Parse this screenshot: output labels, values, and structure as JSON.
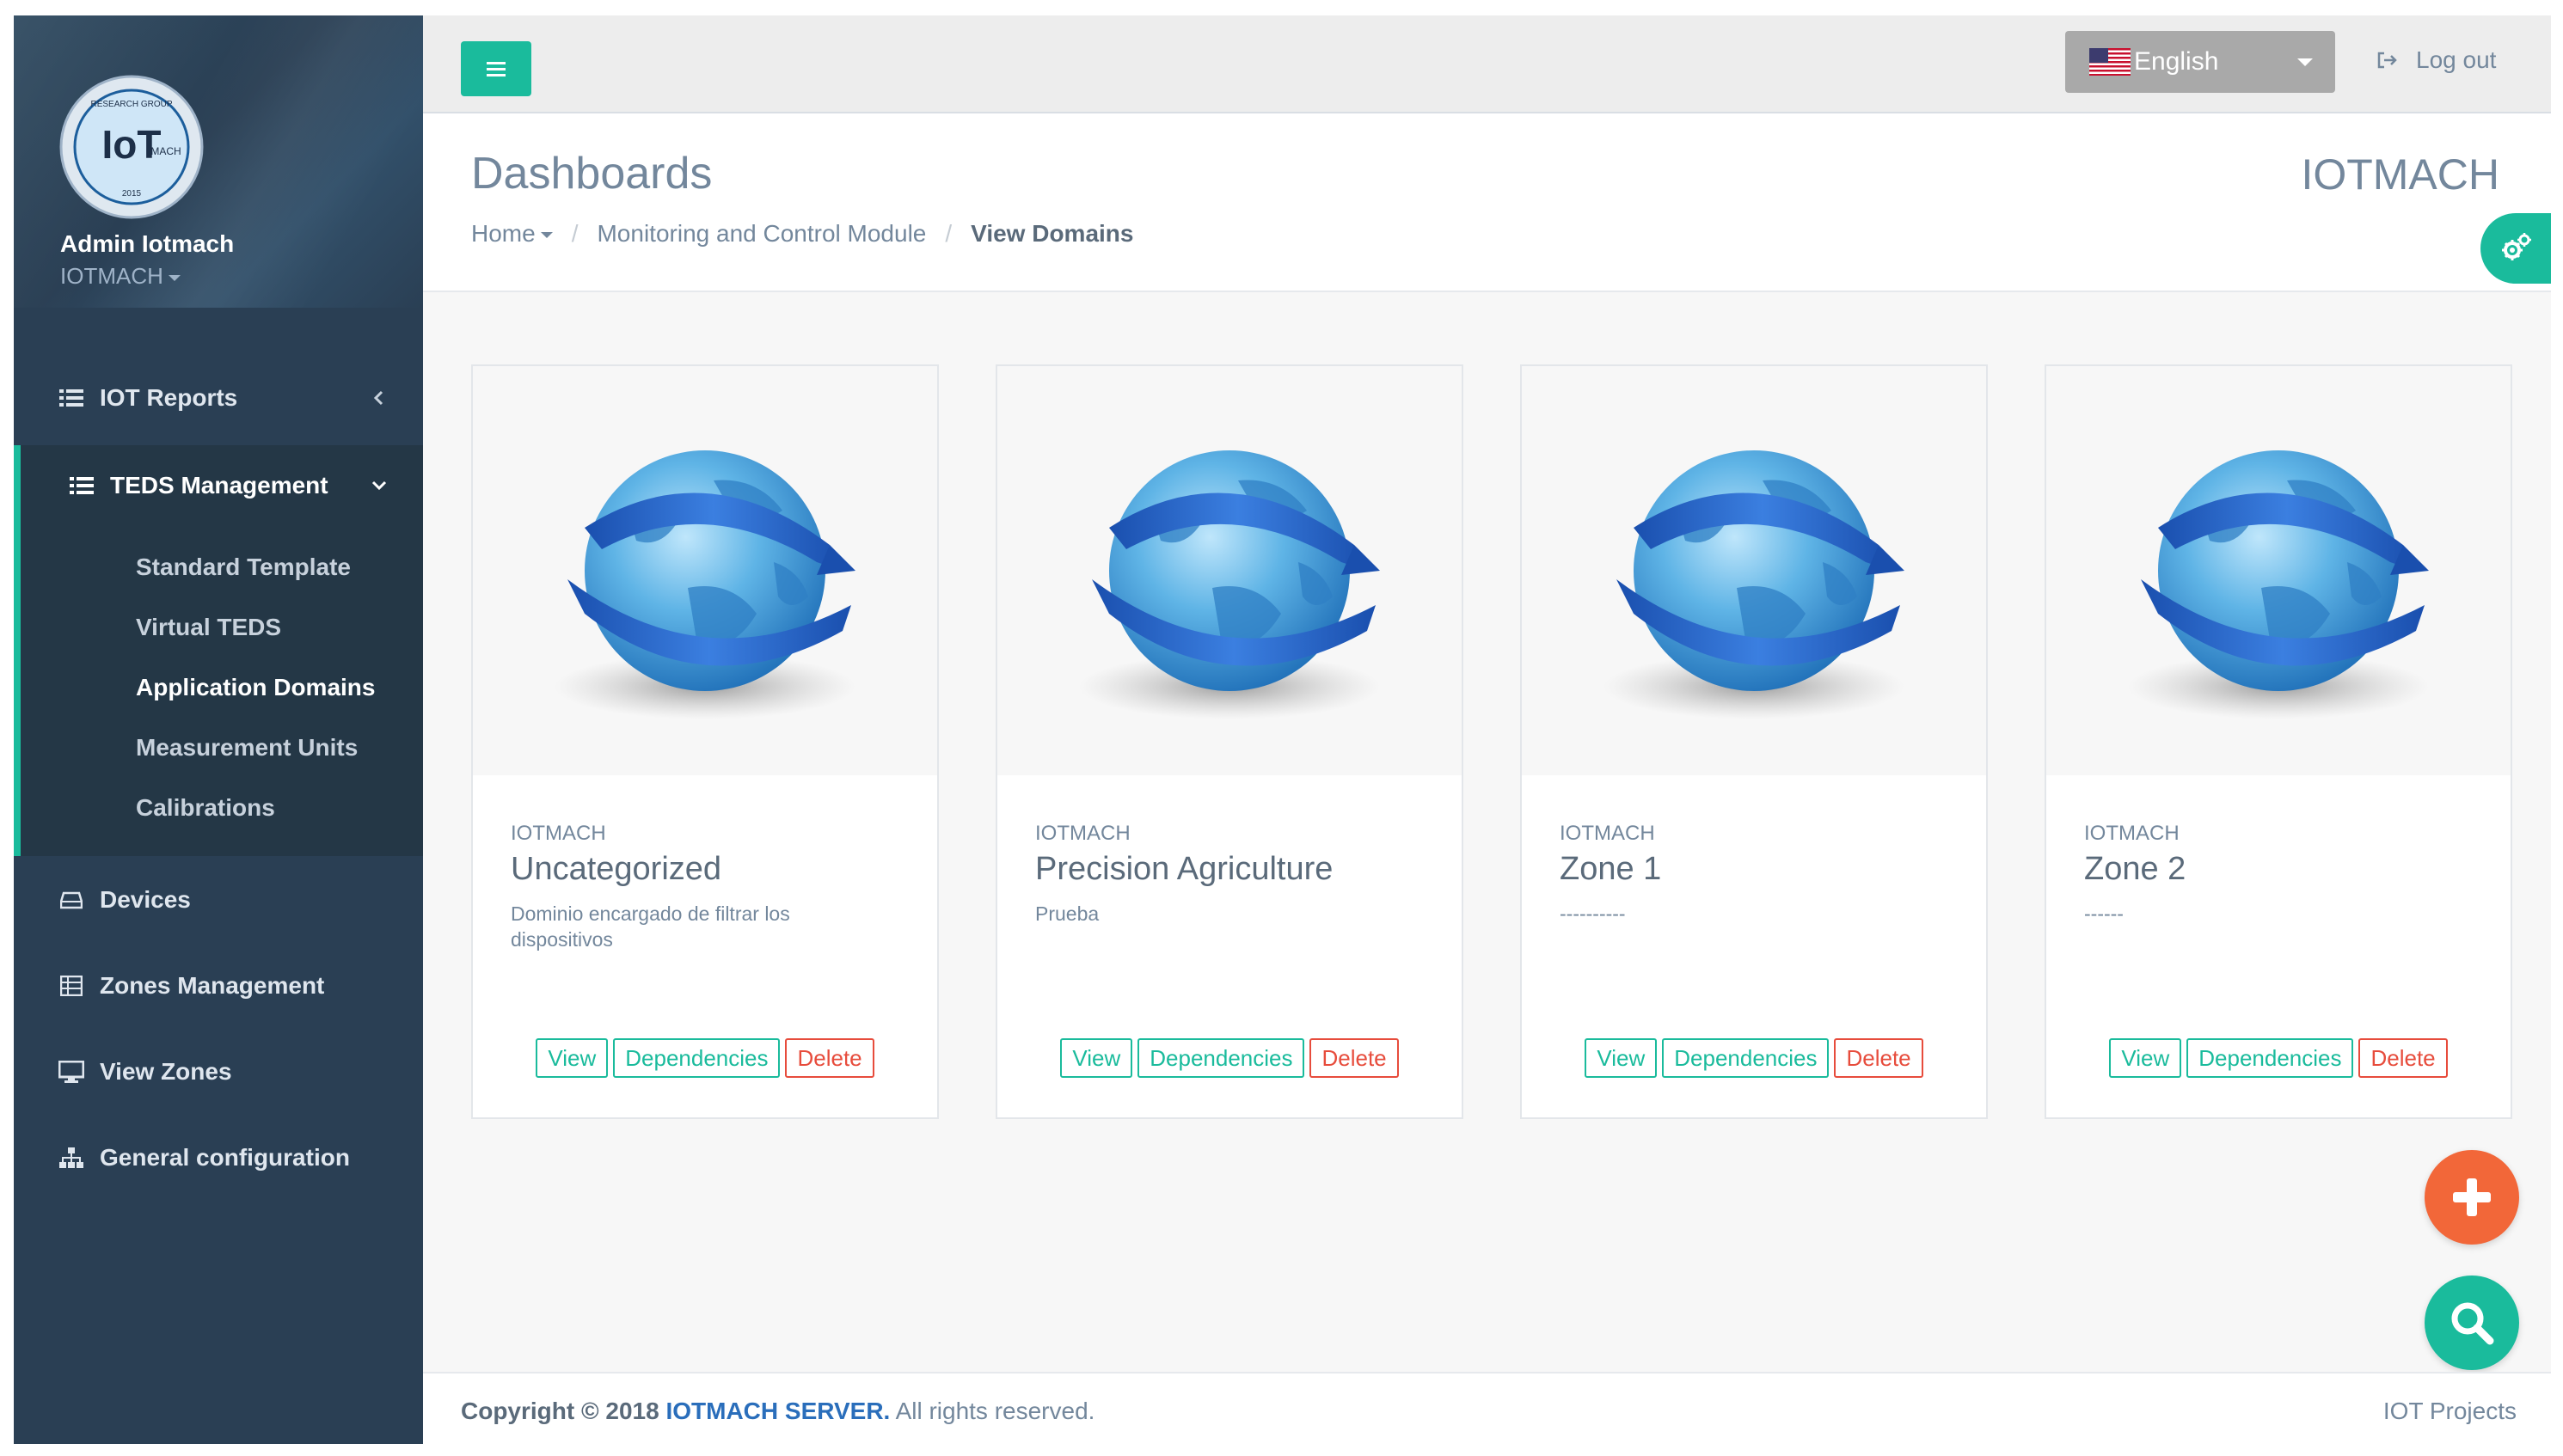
{
  "profile": {
    "name": "Admin Iotmach",
    "org": "IOTMACH"
  },
  "sidebar": {
    "items": [
      {
        "label": "IOT Reports",
        "icon": "list-icon"
      },
      {
        "label": "TEDS Management",
        "icon": "list-icon"
      },
      {
        "label": "Devices",
        "icon": "hdd-icon"
      },
      {
        "label": "Zones Management",
        "icon": "grid-icon"
      },
      {
        "label": "View Zones",
        "icon": "desktop-icon"
      },
      {
        "label": "General configuration",
        "icon": "sitemap-icon"
      }
    ],
    "teds_subitems": [
      "Standard Template",
      "Virtual TEDS",
      "Application Domains",
      "Measurement Units",
      "Calibrations"
    ],
    "active_subitem": "Application Domains"
  },
  "topbar": {
    "language": "English",
    "logout": "Log out"
  },
  "header": {
    "title": "Dashboards",
    "brand": "IOTMACH",
    "breadcrumb": [
      "Home",
      "Monitoring and Control Module",
      "View Domains"
    ]
  },
  "cards": [
    {
      "org": "IOTMACH",
      "title": "Uncategorized",
      "description": "Dominio encargado de filtrar los dispositivos"
    },
    {
      "org": "IOTMACH",
      "title": "Precision Agriculture",
      "description": "Prueba"
    },
    {
      "org": "IOTMACH",
      "title": "Zone 1",
      "description": "----------"
    },
    {
      "org": "IOTMACH",
      "title": "Zone 2",
      "description": "------"
    }
  ],
  "card_actions": {
    "view": "View",
    "dependencies": "Dependencies",
    "delete": "Delete"
  },
  "footer": {
    "copyright": "Copyright © 2018",
    "brand": "IOTMACH SERVER.",
    "rights": "All rights reserved.",
    "right": "IOT Projects"
  },
  "colors": {
    "accent": "#1abb9c",
    "sidebar": "#2a3f54",
    "danger": "#e74c3c",
    "fab_add": "#f26739",
    "link": "#2a6ebb"
  }
}
